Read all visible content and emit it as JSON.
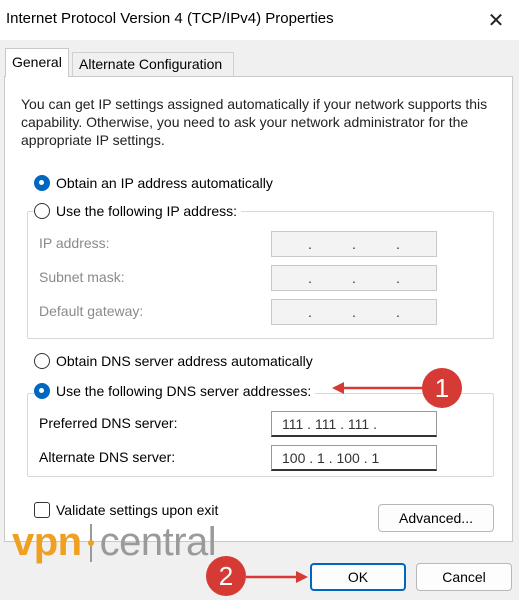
{
  "window": {
    "title": "Internet Protocol Version 4 (TCP/IPv4) Properties",
    "close_glyph": "✕"
  },
  "tabs": [
    {
      "label": "General",
      "active": true
    },
    {
      "label": "Alternate Configuration",
      "active": false
    }
  ],
  "description": "You can get IP settings assigned automatically if your network supports this capability. Otherwise, you need to ask your network administrator for the appropriate IP settings.",
  "ip_section": {
    "auto_label": "Obtain an IP address automatically",
    "auto_selected": true,
    "manual_label": "Use the following IP address:",
    "manual_selected": false,
    "fields": [
      {
        "label": "IP address:",
        "value": "  .    .    .  "
      },
      {
        "label": "Subnet mask:",
        "value": "  .    .    .  "
      },
      {
        "label": "Default gateway:",
        "value": "  .    .    .  "
      }
    ]
  },
  "dns_section": {
    "auto_label": "Obtain DNS server address automatically",
    "auto_selected": false,
    "manual_label": "Use the following DNS server addresses:",
    "manual_selected": true,
    "preferred_label": "Preferred DNS server:",
    "preferred_value": "111 . 111 . 111 .",
    "alternate_label": "Alternate DNS server:",
    "alternate_value": "100 .  1  . 100 . 1"
  },
  "validate": {
    "label": "Validate settings upon exit",
    "checked": false
  },
  "buttons": {
    "advanced": "Advanced...",
    "ok": "OK",
    "cancel": "Cancel"
  },
  "watermark": {
    "left": "vpn",
    "right": "central"
  },
  "annotations": [
    {
      "number": "1"
    },
    {
      "number": "2"
    }
  ],
  "colors": {
    "accent": "#0067c0",
    "annotation": "#d63a34",
    "watermark_orange": "#f0a020"
  }
}
